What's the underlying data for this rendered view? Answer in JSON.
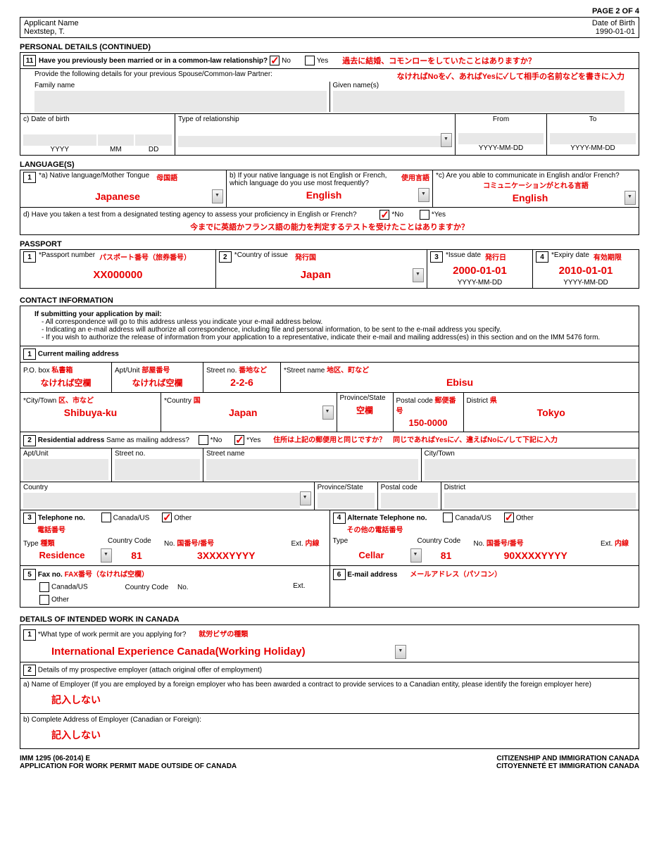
{
  "pageNum": "PAGE 2 OF 4",
  "header": {
    "labelL": "Applicant Name",
    "labelR": "Date of Birth",
    "name": "Nextstep, T.",
    "dob": "1990-01-01"
  },
  "sec_personal_title": "PERSONAL DETAILS (CONTINUED)",
  "q11": {
    "num": "11",
    "q": "Have you previously been married or in a common-law relationship?",
    "no": "No",
    "yes": "Yes",
    "note1": "過去に結婚、コモンローをしていたことはありますか？",
    "note2": "なければNoを✓、あればYesに✓して相手の名前などを書きに入力",
    "provide": "Provide the following details for your previous Spouse/Common-law Partner:",
    "fam": "Family name",
    "given": "Given name(s)",
    "dob": "c) Date of birth",
    "yyyy": "YYYY",
    "mm": "MM",
    "dd": "DD",
    "type": "Type of relationship",
    "from": "From",
    "to": "To",
    "ymd": "YYYY-MM-DD"
  },
  "sec_lang_title": "LANGUAGE(S)",
  "lang": {
    "num": "1",
    "a": "*a) Native language/Mother Tongue",
    "a_note": "母国語",
    "a_val": "Japanese",
    "b": "b) If your native language is not English or French, which language do you use most frequently?",
    "b_note": "使用言語",
    "b_val": "English",
    "c": "*c) Are you able to communicate in English and/or French?",
    "c_note": "コミュニケーションがとれる言語",
    "c_val": "English",
    "d": "d) Have you taken a test from a designated testing agency to assess your proficiency in English or French?",
    "dno": "*No",
    "dyes": "*Yes",
    "d_note": "今までに英語かフランス語の能力を判定するテストを受けたことはありますか？"
  },
  "sec_pass_title": "PASSPORT",
  "pass": {
    "n1": "1",
    "f1": "*Passport number",
    "f1_note": "パスポート番号（旅券番号）",
    "f1_val": "XX000000",
    "n2": "2",
    "f2": "*Country of issue",
    "f2_note": "発行国",
    "f2_val": "Japan",
    "n3": "3",
    "f3": "*Issue date",
    "f3_note": "発行日",
    "f3_val": "2000-01-01",
    "n4": "4",
    "f4": "*Expiry date",
    "f4_note": "有効期限",
    "f4_val": "2010-01-01",
    "ymd": "YYYY-MM-DD"
  },
  "sec_contact_title": "CONTACT INFORMATION",
  "contact": {
    "intro": "If submitting your application by mail:",
    "b1": "All correspondence will go to this address unless you indicate your e-mail address below.",
    "b2": "Indicating an e-mail address will authorize all correspondence, including file and personal information, to be sent to the e-mail address you specify.",
    "b3": "If you wish to authorize the release of information from your application to a representative, indicate their e-mail and mailing address(es) in this section and on the IMM 5476 form.",
    "n1": "1",
    "cur": "Current mailing address",
    "po": "P.O. box",
    "po_note": "私書箱",
    "po_val": "なければ空欄",
    "apt": "Apt/Unit",
    "apt_note": "部屋番号",
    "apt_val": "なければ空欄",
    "stno": "Street no.",
    "stno_note": "番地など",
    "stno_val": "2-2-6",
    "stname": "*Street name",
    "stname_note": "地区、町など",
    "stname_val": "Ebisu",
    "city": "*City/Town",
    "city_note": "区、市など",
    "city_val": "Shibuya-ku",
    "country": "*Country",
    "country_note": "国",
    "country_val": "Japan",
    "prov": "Province/State",
    "prov_val": "空欄",
    "postal": "Postal code",
    "postal_note": "郵便番号",
    "postal_val": "150-0000",
    "dist": "District",
    "dist_note": "県",
    "dist_val": "Tokyo",
    "n2": "2",
    "res": "Residential address",
    "same": "Same as mailing address?",
    "sno": "*No",
    "syes": "*Yes",
    "res_note": "住所は上記の郵便用と同じですか？　同じであればYesに✓、違えばNoに✓して下記に入力",
    "r_apt": "Apt/Unit",
    "r_stno": "Street no.",
    "r_stname": "Street name",
    "r_city": "City/Town",
    "r_country": "Country",
    "r_prov": "Province/State",
    "r_postal": "Postal code",
    "r_dist": "District",
    "n3": "3",
    "tel": "Telephone no.",
    "tel_note": "電話番号",
    "cus": "Canada/US",
    "other": "Other",
    "type": "Type",
    "type_note": "種類",
    "cc": "Country Code",
    "no": "No.",
    "no_note": "国番号/番号",
    "ext": "Ext.",
    "ext_note": "内線",
    "tel_type_val": "Residence",
    "tel_cc_val": "81",
    "tel_no_val": "3XXXXYYYY",
    "n4": "4",
    "alt": "Alternate Telephone no.",
    "alt_note": "その他の電話番号",
    "alt_type_val": "Cellar",
    "alt_cc_val": "81",
    "alt_no_val": "90XXXXYYYY",
    "n5": "5",
    "fax": "Fax no.",
    "fax_note": "FAX番号（なければ空欄）",
    "n6": "6",
    "email": "E-mail address",
    "email_note": "メールアドレス（パソコン）"
  },
  "sec_work_title": "DETAILS OF INTENDED WORK IN CANADA",
  "work": {
    "n1": "1",
    "q1": "*What type of work permit are you applying for?",
    "q1_note": "就労ビザの種類",
    "q1_val": "International Experience Canada(Working Holiday)",
    "n2": "2",
    "q2": "Details of my prospective employer (attach original offer of employment)",
    "qa": "a) Name of Employer (If you are employed by a foreign employer who has been awarded a contract to provide services to a Canadian entity, please identify the foreign employer here)",
    "qa_val": "記入しない",
    "qb": "b) Complete Address of Employer (Canadian or Foreign):",
    "qb_val": "記入しない"
  },
  "footer": {
    "l1": "IMM 1295 (06-2014) E",
    "l2": "APPLICATION FOR WORK PERMIT MADE OUTSIDE OF CANADA",
    "r1": "CITIZENSHIP AND IMMIGRATION CANADA",
    "r2": "CITOYENNETÉ ET IMMIGRATION CANADA"
  }
}
